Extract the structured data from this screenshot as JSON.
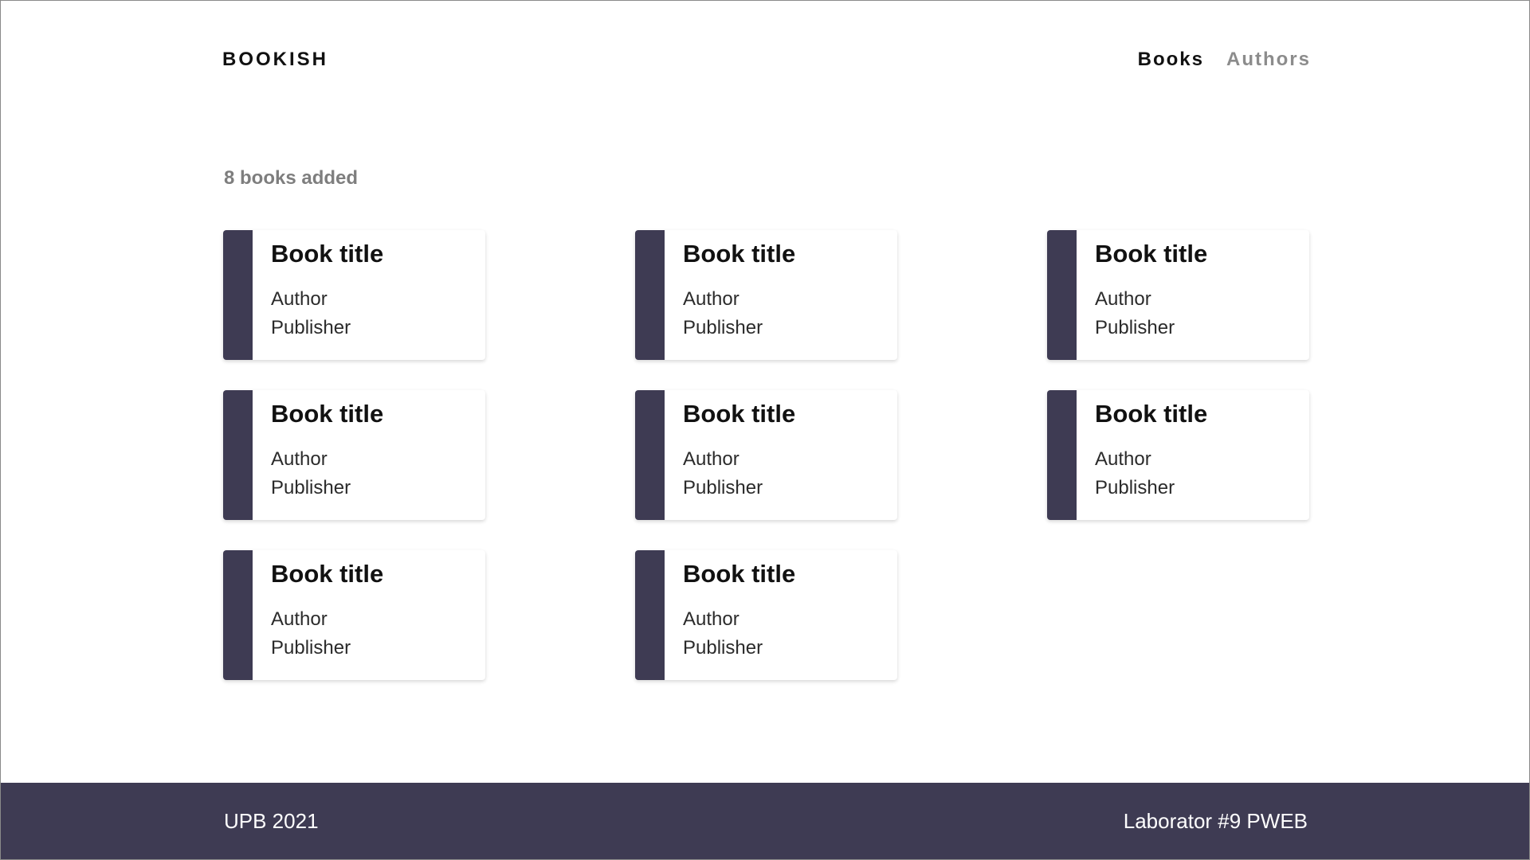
{
  "header": {
    "brand": "BOOKISH",
    "nav": [
      {
        "label": "Books",
        "active": true
      },
      {
        "label": "Authors",
        "active": false
      }
    ]
  },
  "main": {
    "count_text": "8 books added",
    "books": [
      {
        "title": "Book title",
        "author": "Author",
        "publisher": "Publisher"
      },
      {
        "title": "Book title",
        "author": "Author",
        "publisher": "Publisher"
      },
      {
        "title": "Book title",
        "author": "Author",
        "publisher": "Publisher"
      },
      {
        "title": "Book title",
        "author": "Author",
        "publisher": "Publisher"
      },
      {
        "title": "Book title",
        "author": "Author",
        "publisher": "Publisher"
      },
      {
        "title": "Book title",
        "author": "Author",
        "publisher": "Publisher"
      },
      {
        "title": "Book title",
        "author": "Author",
        "publisher": "Publisher"
      },
      {
        "title": "Book title",
        "author": "Author",
        "publisher": "Publisher"
      }
    ]
  },
  "footer": {
    "left": "UPB 2021",
    "right": "Laborator #9 PWEB"
  },
  "colors": {
    "accent": "#3e3b53",
    "nav_active": "#111111",
    "nav_inactive": "#8c8c8c",
    "muted_text": "#7e7e7e"
  }
}
